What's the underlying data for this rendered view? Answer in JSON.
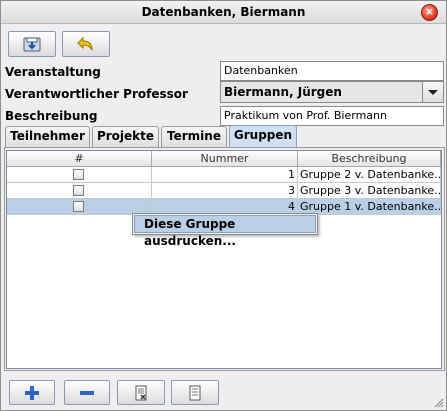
{
  "window": {
    "title": "Datenbanken, Biermann",
    "close_glyph": "×"
  },
  "toolbar": [
    {
      "name": "save-icon",
      "action": "save"
    },
    {
      "name": "undo-icon",
      "action": "undo"
    }
  ],
  "form": {
    "veranstaltung_label": "Veranstaltung",
    "veranstaltung_value": "Datenbanken",
    "professor_label": "Verantwortlicher Professor",
    "professor_value": "Biermann, Jürgen",
    "beschreibung_label": "Beschreibung",
    "beschreibung_value": "Praktikum von Prof. Biermann"
  },
  "tabs": [
    {
      "label": "Teilnehmer",
      "active": false
    },
    {
      "label": "Projekte",
      "active": false
    },
    {
      "label": "Termine",
      "active": false
    },
    {
      "label": "Gruppen",
      "active": true
    }
  ],
  "table": {
    "columns": [
      "#",
      "Nummer",
      "Beschreibung"
    ],
    "rows": [
      {
        "checked": false,
        "nummer": "1",
        "beschreibung": "Gruppe 2 v. Datenbanke...",
        "selected": false
      },
      {
        "checked": false,
        "nummer": "3",
        "beschreibung": "Gruppe 3 v. Datenbanke...",
        "selected": false
      },
      {
        "checked": false,
        "nummer": "4",
        "beschreibung": "Gruppe 1 v. Datenbanke...",
        "selected": true
      }
    ]
  },
  "context_menu": {
    "item": "Diese Gruppe ausdrucken..."
  },
  "bottom_toolbar": [
    {
      "name": "add-icon"
    },
    {
      "name": "remove-icon"
    },
    {
      "name": "edit-document-icon"
    },
    {
      "name": "document-icon"
    }
  ],
  "colors": {
    "selection": "#b8cfe5",
    "active_tab": "#cfe0f2",
    "add_icon": "#2f63c8"
  }
}
